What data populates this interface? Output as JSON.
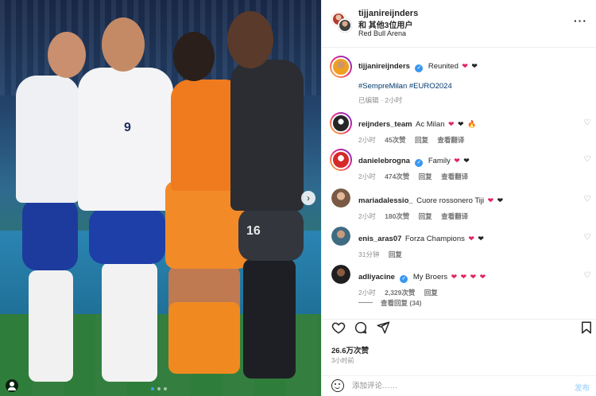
{
  "header": {
    "username": "tijjanireijnders",
    "others": "和 其他3位用户",
    "location": "Red Bull Arena",
    "more_label": "···"
  },
  "photo": {
    "jersey_number_left": "9",
    "jersey_number_right": "16",
    "next_label": "›",
    "carousel": {
      "count": 3,
      "active": 1
    }
  },
  "caption": {
    "username": "tijjanireijnders",
    "text": "Reunited",
    "hashtags": "#SempreMilan #EURO2024",
    "edited": "已编辑",
    "time": "2小时"
  },
  "comments": [
    {
      "username": "reijnders_team",
      "verified": false,
      "text": "Ac Milan",
      "emoji": [
        "red-heart",
        "black-heart",
        "fire"
      ],
      "time": "2小时",
      "likes": "45次赞",
      "reply": "回复",
      "translate": "查看翻译"
    },
    {
      "username": "danielebrogna",
      "verified": true,
      "text": "Family",
      "emoji": [
        "red-heart",
        "black-heart"
      ],
      "time": "2小时",
      "likes": "474次赞",
      "reply": "回复",
      "translate": "查看翻译"
    },
    {
      "username": "mariadalessio_",
      "verified": false,
      "text": "Cuore rossonero Tiji",
      "emoji": [
        "red-heart",
        "black-heart"
      ],
      "time": "2小时",
      "likes": "180次赞",
      "reply": "回复",
      "translate": "查看翻译"
    },
    {
      "username": "enis_aras07",
      "verified": false,
      "text": "Forza Champions",
      "emoji": [
        "red-heart",
        "black-heart"
      ],
      "time": "31分钟",
      "likes": "",
      "reply": "回复",
      "translate": ""
    },
    {
      "username": "adliyacine",
      "verified": true,
      "text": "My Broers",
      "emoji": [
        "red-heart",
        "red-heart",
        "red-heart",
        "red-heart"
      ],
      "time": "2小时",
      "likes": "2,329次赞",
      "reply": "回复",
      "translate": ""
    }
  ],
  "view_replies": "查看回复 (34)",
  "actions": {
    "icons": [
      "heart-icon",
      "comment-icon",
      "share-icon",
      "bookmark-icon"
    ]
  },
  "likes": "26.6万次赞",
  "posted": "3小时前",
  "composer": {
    "placeholder": "添加评论……",
    "post_label": "发布"
  },
  "colors": {
    "verified": "#3897f0",
    "hashtag": "#00376b",
    "heart_red": "#e0245e",
    "muted": "#8e8e8e"
  }
}
